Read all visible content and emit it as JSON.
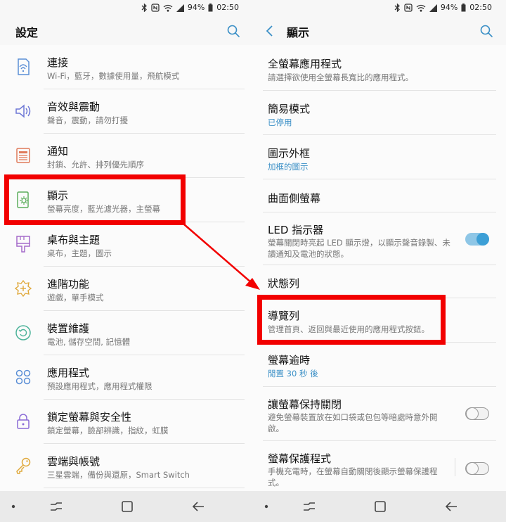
{
  "status_bar": {
    "battery": "94%",
    "time": "02:50",
    "icons": [
      "bluetooth-icon",
      "nfc-icon",
      "wifi-icon",
      "signal-icon"
    ]
  },
  "left": {
    "title": "設定",
    "items": [
      {
        "title": "連接",
        "subtitle": "Wi-Fi，藍牙，數據使用量，飛航模式",
        "icon": "connection-icon"
      },
      {
        "title": "音效與震動",
        "subtitle": "聲音，震動，請勿打擾",
        "icon": "sound-icon"
      },
      {
        "title": "通知",
        "subtitle": "封鎖、允許、排列優先順序",
        "icon": "notification-icon"
      },
      {
        "title": "顯示",
        "subtitle": "螢幕亮度，藍光濾光器，主螢幕",
        "icon": "display-icon"
      },
      {
        "title": "桌布與主題",
        "subtitle": "桌布，主題，圖示",
        "icon": "wallpaper-icon"
      },
      {
        "title": "進階功能",
        "subtitle": "遊戲，單手模式",
        "icon": "advanced-icon"
      },
      {
        "title": "裝置維護",
        "subtitle": "電池, 儲存空間, 記憶體",
        "icon": "maintenance-icon"
      },
      {
        "title": "應用程式",
        "subtitle": "預設應用程式，應用程式權限",
        "icon": "apps-icon"
      },
      {
        "title": "鎖定螢幕與安全性",
        "subtitle": "鎖定螢幕，臉部辨識，指紋，虹膜",
        "icon": "lock-icon"
      },
      {
        "title": "雲端與帳號",
        "subtitle": "三星雲端，備份與還原，Smart Switch",
        "icon": "key-icon"
      }
    ]
  },
  "right": {
    "title": "顯示",
    "items": [
      {
        "title": "全螢幕應用程式",
        "subtitle": "請選擇欲使用全螢幕長寬比的應用程式。"
      },
      {
        "title": "簡易模式",
        "subtitle": "已停用"
      },
      {
        "title": "圖示外框",
        "subtitle": "加框的圖示"
      },
      {
        "title": "曲面側螢幕",
        "subtitle": ""
      },
      {
        "title": "LED 指示器",
        "subtitle": "螢幕關閉時亮起 LED 顯示燈，以顯示聲音錄製、未讀通知及電池的狀態。",
        "toggle": true
      },
      {
        "title": "狀態列",
        "subtitle": ""
      },
      {
        "title": "導覽列",
        "subtitle": "管理首頁、返回與最近使用的應用程式按鈕。"
      },
      {
        "title": "螢幕逾時",
        "subtitle": "閒置 30 秒 後"
      },
      {
        "title": "讓螢幕保持關閉",
        "subtitle": "避免螢幕裝置放在如口袋或包包等暗處時意外開啟。",
        "toggle": false
      },
      {
        "title": "螢幕保護程式",
        "subtitle": "手機充電時，在螢幕自動關閉後顯示螢幕保護程式。",
        "toggle": false
      }
    ]
  },
  "colors": {
    "highlight": "#f20000",
    "accent": "#3a8fc6",
    "toggle_on": "#3c9fd6"
  }
}
